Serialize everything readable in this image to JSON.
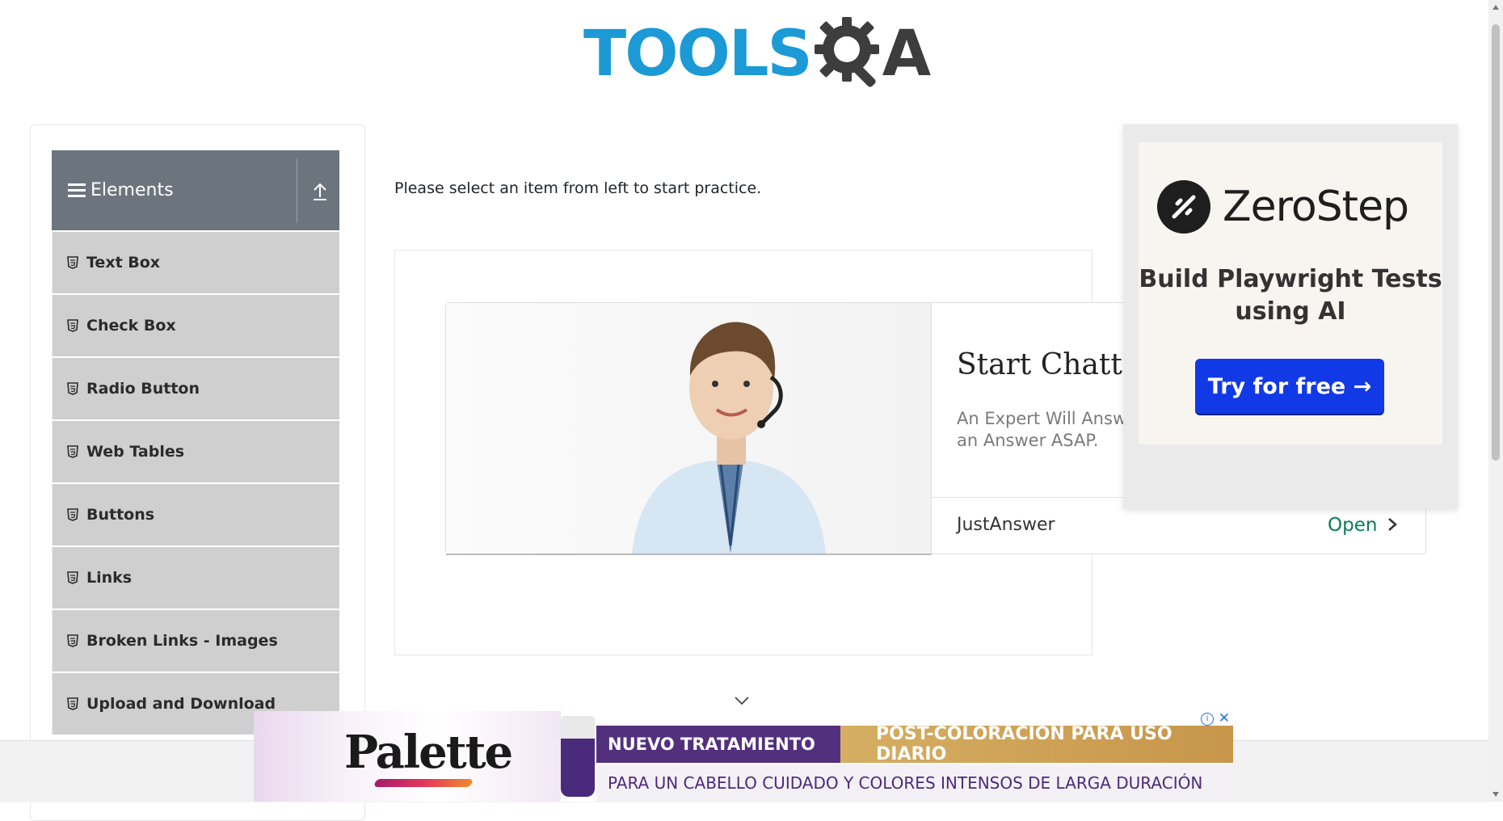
{
  "header": {
    "logo_left": "TOOLS",
    "logo_right": "A"
  },
  "sidebar": {
    "group_title": "Elements",
    "items": [
      {
        "label": "Text Box"
      },
      {
        "label": "Check Box"
      },
      {
        "label": "Radio Button"
      },
      {
        "label": "Web Tables"
      },
      {
        "label": "Buttons"
      },
      {
        "label": "Links"
      },
      {
        "label": "Broken Links - Images"
      },
      {
        "label": "Upload and Download"
      }
    ]
  },
  "main": {
    "intro_text": "Please select an item from left to start practice."
  },
  "ad_justanswer": {
    "title": "Start Chatting",
    "subtitle": "An Expert Will Answer an Answer ASAP.",
    "brand": "JustAnswer",
    "cta": "Open"
  },
  "ad_zerostep": {
    "brand": "ZeroStep",
    "tagline": "Build Playwright Tests using AI",
    "cta": "Try for free →"
  },
  "banner_ad": {
    "brand": "Palette",
    "line1_left": "NUEVO TRATAMIENTO",
    "line1_right": "POST-COLORACIÓN PARA USO DIARIO",
    "line2": "PARA UN CABELLO CUIDADO Y COLORES INTENSOS DE LARGA DURACIÓN",
    "info": "i",
    "close": "✕"
  },
  "colors": {
    "logo_blue": "#1b9ad6",
    "logo_dark": "#3d3d3d",
    "group_header": "#6c757d",
    "menu_item": "#cfcfcf",
    "zerostep_button": "#1239e6",
    "justanswer_open": "#0d7d55"
  }
}
